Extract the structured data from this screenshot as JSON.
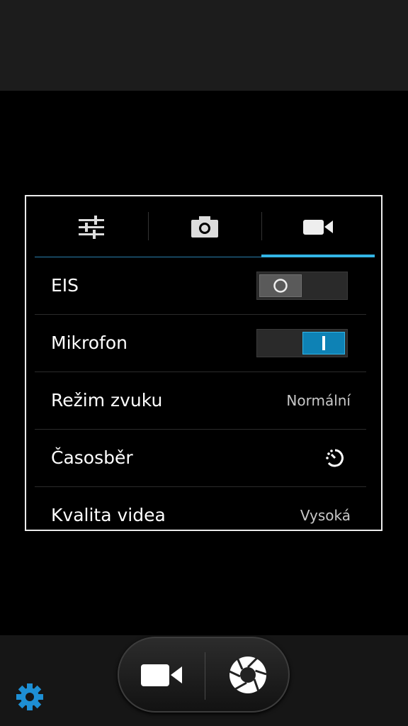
{
  "tabs": [
    {
      "icon": "sliders-icon",
      "active": false
    },
    {
      "icon": "camera-icon",
      "active": false
    },
    {
      "icon": "video-camera-icon",
      "active": true
    }
  ],
  "settings": {
    "eis": {
      "label": "EIS",
      "state": "off",
      "knob_symbol": "O"
    },
    "microphone": {
      "label": "Mikrofon",
      "state": "on",
      "knob_symbol": "I"
    },
    "sound_mode": {
      "label": "Režim zvuku",
      "value": "Normální"
    },
    "timelapse": {
      "label": "Časosběr",
      "icon": "timer-icon"
    },
    "video_quality": {
      "label": "Kvalita videa",
      "value": "Vysoká"
    }
  },
  "bottom": {
    "video_button_icon": "video-camera-icon",
    "shutter_button_icon": "shutter-icon",
    "settings_icon": "gear-icon"
  },
  "colors": {
    "accent": "#33b5e5",
    "toggle_on": "#0e82b5",
    "gear": "#1e8fd4"
  }
}
